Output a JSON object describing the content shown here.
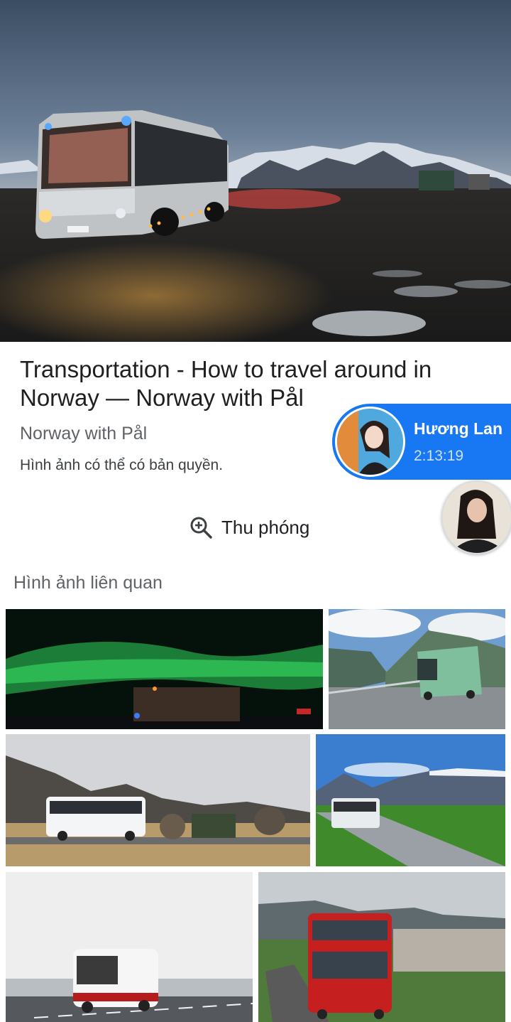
{
  "result": {
    "title": "Transportation - How to travel around in Norway — Norway with Pål",
    "source": "Norway with Pål",
    "copyright_notice": "Hình ảnh có thể có bản quyền.",
    "zoom_label": "Thu phóng"
  },
  "related": {
    "heading": "Hình ảnh liên quan"
  },
  "chat_head": {
    "name": "Hương Lan",
    "time": "2:13:19"
  },
  "icons": {
    "zoom": "zoom-in-icon"
  },
  "colors": {
    "messenger_blue": "#1877f2",
    "text_secondary": "#5f6368"
  }
}
